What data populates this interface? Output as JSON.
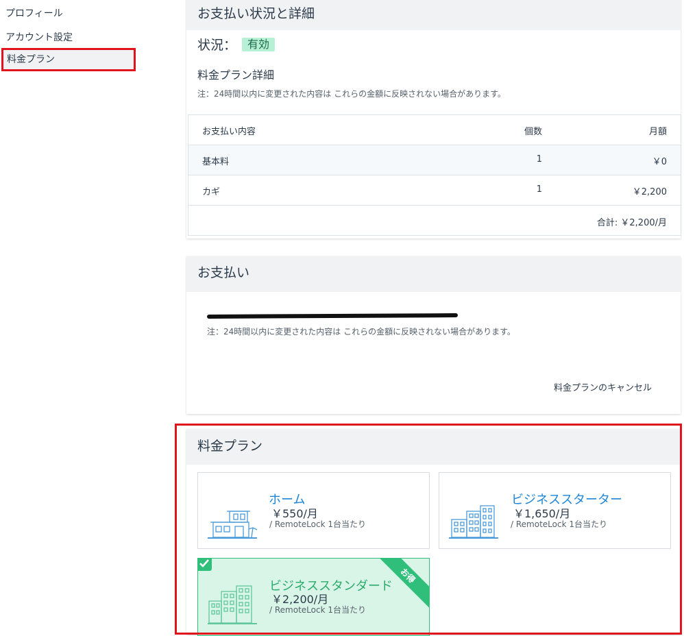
{
  "sidebar": {
    "items": [
      {
        "label": "プロフィール"
      },
      {
        "label": "アカウント設定"
      },
      {
        "label": "料金プラン"
      }
    ]
  },
  "status_card": {
    "title": "お支払い状況と詳細",
    "status_label": "状況：",
    "status_value": "有効",
    "details_title": "料金プラン詳細",
    "note": "注：24時間以内に変更された内容は これらの金額に反映されない場合があります。",
    "table": {
      "headers": [
        "お支払い内容",
        "個数",
        "月額"
      ],
      "rows": [
        {
          "item": "基本料",
          "qty": "1",
          "amount": "￥0"
        },
        {
          "item": "カギ",
          "qty": "1",
          "amount": "￥2,200"
        }
      ],
      "total": "合計: ￥2,200/月"
    }
  },
  "payment_card": {
    "title": "お支払い",
    "note": "注：24時間以内に変更された内容は これらの金額に反映されない場合があります。",
    "cancel_link": "料金プランのキャンセル"
  },
  "plans_card": {
    "title": "料金プラン",
    "plans": [
      {
        "name": "ホーム",
        "price": "￥550/月",
        "unit": "/ RemoteLock 1台当たり"
      },
      {
        "name": "ビジネススターター",
        "price": "￥1,650/月",
        "unit": "/ RemoteLock 1台当たり"
      },
      {
        "name": "ビジネススタンダード",
        "price": "￥2,200/月",
        "unit": "/ RemoteLock 1台当たり",
        "ribbon": "お得"
      }
    ]
  },
  "colors": {
    "accent_blue": "#1e86d8",
    "accent_green": "#2aab6b",
    "highlight_red": "#e0141c"
  }
}
